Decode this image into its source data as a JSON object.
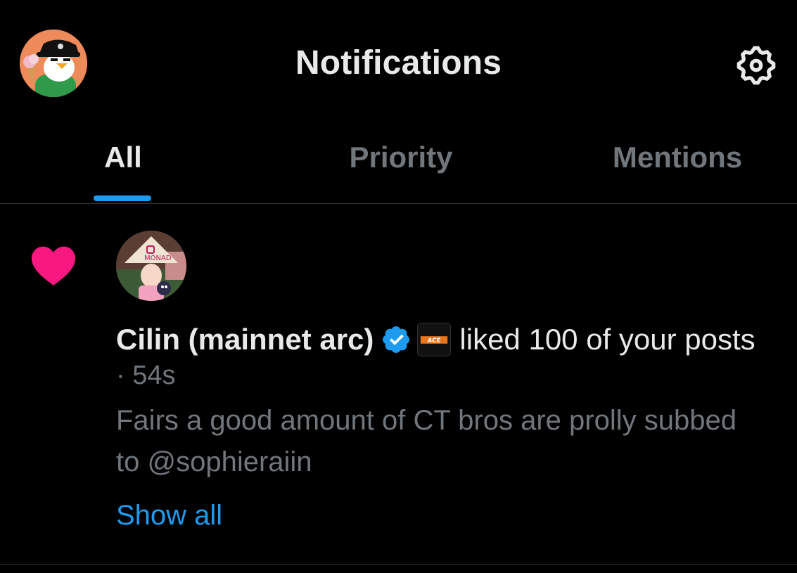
{
  "header": {
    "title": "Notifications",
    "settings_icon": "gear-icon",
    "avatar_icon": "penguin-avatar"
  },
  "tabs": [
    {
      "label": "All",
      "active": true
    },
    {
      "label": "Priority",
      "active": false
    },
    {
      "label": "Mentions",
      "active": false
    }
  ],
  "notification": {
    "type_icon": "heart-icon",
    "user_name": "Cilin (mainnet arc)",
    "verified_icon": "verified-badge-icon",
    "affiliate_badge_text": "ACE",
    "action_text": "liked 100 of your posts",
    "timestamp": "· 54s",
    "post_text": "Fairs a good amount of CT bros are prolly subbed to @sophieraiin",
    "show_all_label": "Show all"
  },
  "colors": {
    "background": "#000000",
    "primary_text": "#e7e9ea",
    "secondary_text": "#71767b",
    "accent": "#1d9bf0",
    "like": "#f91880",
    "divider": "#2f3336"
  }
}
